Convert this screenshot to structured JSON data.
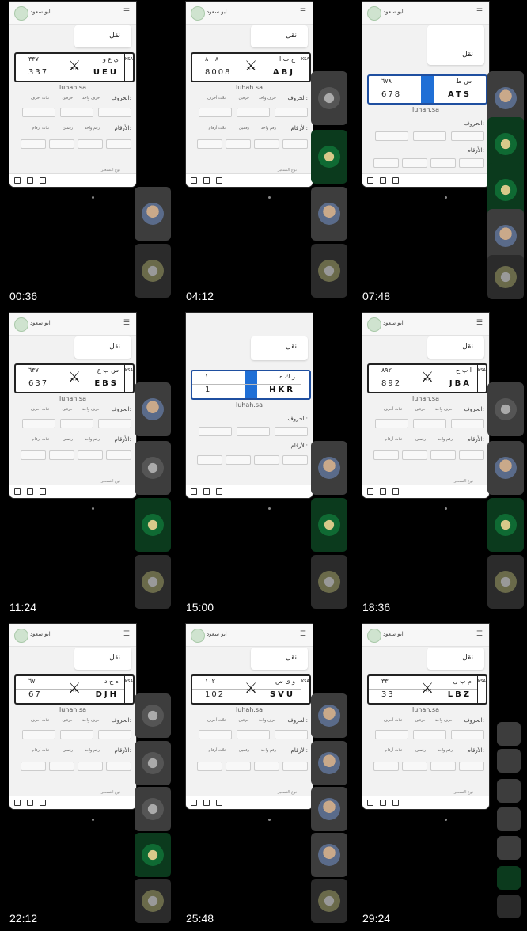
{
  "header": {
    "user_name": "ابو سعود",
    "naql_label": "نقل"
  },
  "site": "luhah.sa",
  "form": {
    "letters_label": "الحروف:",
    "numbers_label": "الأرقام:",
    "letters_options": [
      "حرف واحد",
      "حرفين",
      "ثلاث أحرف"
    ],
    "numbers_options": [
      "رقم واحد",
      "رقمين",
      "ثلاث أرقام",
      "أربع أرقام"
    ],
    "type_hint": "نوع التسعير"
  },
  "cells": [
    {
      "time": "00:36",
      "ar_nums": "٣٣٧",
      "ar_letters": "ي ع و",
      "lat_nums": "337",
      "lat_letters": "UEU"
    },
    {
      "time": "04:12",
      "ar_nums": "٨٠٠٨",
      "ar_letters": "ح ب ا",
      "lat_nums": "8008",
      "lat_letters": "ABJ"
    },
    {
      "time": "07:48",
      "ar_nums": "٦٧٨",
      "ar_letters": "س ط ا",
      "lat_nums": "678",
      "lat_letters": "ATS"
    },
    {
      "time": "11:24",
      "ar_nums": "٦٣٧",
      "ar_letters": "س ب ع",
      "lat_nums": "637",
      "lat_letters": "EBS"
    },
    {
      "time": "15:00",
      "ar_nums": "١",
      "ar_letters": "ر ك ه",
      "lat_nums": "1",
      "lat_letters": "HKR"
    },
    {
      "time": "18:36",
      "ar_nums": "٨٩٢",
      "ar_letters": "ا ب ح",
      "lat_nums": "892",
      "lat_letters": "JBA"
    },
    {
      "time": "22:12",
      "ar_nums": "٦٧",
      "ar_letters": "ه ح د",
      "lat_nums": "67",
      "lat_letters": "DJH"
    },
    {
      "time": "25:48",
      "ar_nums": "١٠٢",
      "ar_letters": "و ى س",
      "lat_nums": "102",
      "lat_letters": "SVU"
    },
    {
      "time": "29:24",
      "ar_nums": "٣٣",
      "ar_letters": "م ب ل",
      "lat_nums": "33",
      "lat_letters": "LBZ"
    }
  ],
  "ksa_label": "KSA"
}
